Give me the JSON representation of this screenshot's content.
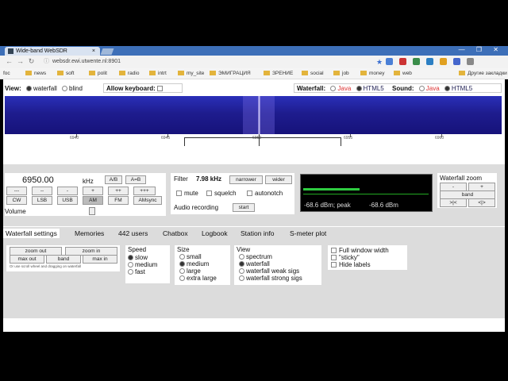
{
  "browser": {
    "tab_title": "Wide-band WebSDR",
    "close_glyph": "×",
    "window_controls": "— ❐ ✕",
    "url": "websdr.ewi.utwente.nl:8901",
    "bookmarks": [
      "foc",
      "news",
      "soft",
      "polit",
      "radio",
      "intrt",
      "my_site",
      "ЭМИГРАЦИЯ",
      "ЗРЕНИЕ",
      "social",
      "job",
      "money",
      "web",
      "Другие закладки"
    ]
  },
  "viewbar": {
    "view_label": "View:",
    "view_opt1": "waterfall",
    "view_opt2": "blind",
    "allow_kb_label": "Allow keyboard:",
    "waterfall_label": "Waterfall:",
    "wf_java": "Java",
    "wf_html5": "HTML5",
    "sound_label": "Sound:",
    "snd_java": "Java",
    "snd_html5": "HTML5"
  },
  "scale": {
    "ticks": [
      "6940",
      "6945",
      "6950",
      "6955",
      "6960"
    ]
  },
  "tuning": {
    "frequency": "6950.00",
    "unit": "kHz",
    "ab_label": "A/B",
    "a_eq_b_label": "A=B",
    "step_buttons": [
      "---",
      "--",
      "-",
      "+",
      "++",
      "+++"
    ],
    "modes": [
      "CW",
      "LSB",
      "USB",
      "AM",
      "FM",
      "AMsync"
    ],
    "active_mode": "AM",
    "volume_label": "Volume"
  },
  "filter": {
    "label": "Filter",
    "bandwidth": "7.98 kHz",
    "narrower": "narrower",
    "wider": "wider",
    "mute": "mute",
    "squelch": "squelch",
    "autonotch": "autonotch",
    "recording_label": "Audio recording",
    "start": "start"
  },
  "smeter": {
    "readout_left": "-68.6 dBm; peak",
    "readout_right": "-68.6 dBm",
    "level_fraction": 0.45,
    "bar_color": "#2ecc40"
  },
  "wfzoom": {
    "title": "Waterfall zoom",
    "minus": "-",
    "plus": "+",
    "band": "band",
    "left": ">|<",
    "right": "<|>"
  },
  "tabs": [
    "Waterfall settings",
    "Memories",
    "442 users",
    "Chatbox",
    "Logbook",
    "Station info",
    "S-meter plot"
  ],
  "settings": {
    "zoom_out": "zoom out",
    "zoom_in": "zoom in",
    "max_out": "max out",
    "band": "band",
    "max_in": "max in",
    "hint": "Or use scroll wheel and dragging on waterfall",
    "speed_title": "Speed",
    "speed_opts": [
      "slow",
      "medium",
      "fast"
    ],
    "size_title": "Size",
    "size_opts": [
      "small",
      "medium",
      "large",
      "extra large"
    ],
    "view_title": "View",
    "view_opts": [
      "spectrum",
      "waterfall",
      "waterfall weak sigs",
      "waterfall strong sigs"
    ],
    "opt_full_width": "Full window width",
    "opt_sticky": "\"sticky\"",
    "opt_hide_labels": "Hide labels"
  }
}
